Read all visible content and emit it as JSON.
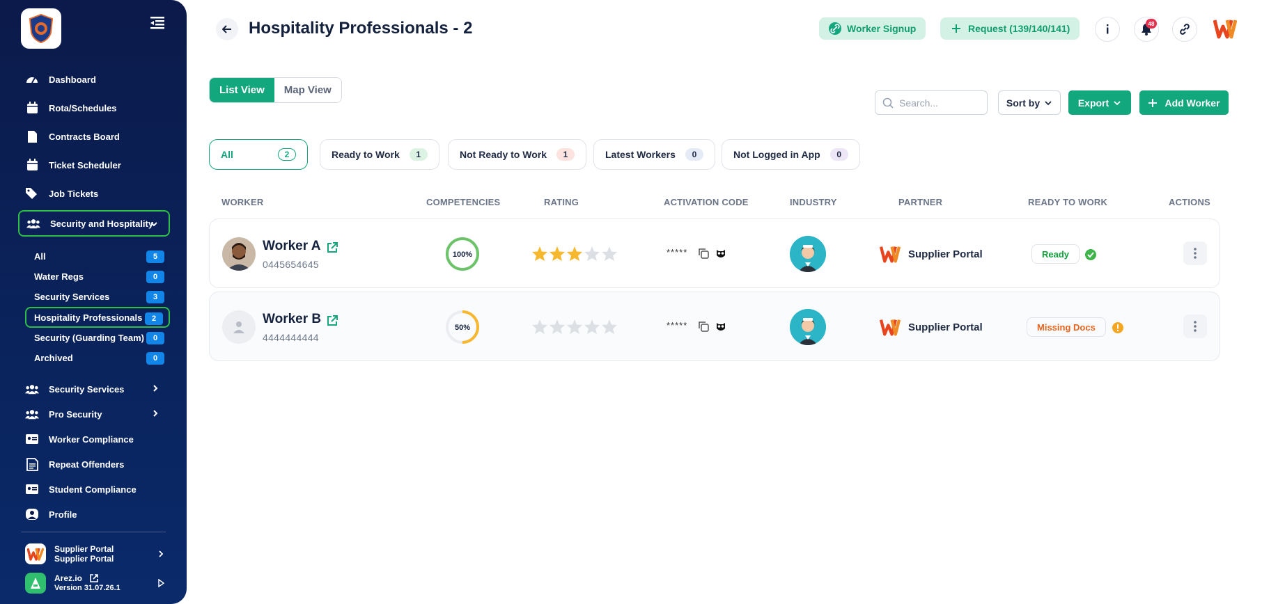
{
  "sidebar": {
    "nav": [
      {
        "label": "Dashboard",
        "icon": "gauge-icon"
      },
      {
        "label": "Rota/Schedules",
        "icon": "calendar-icon"
      },
      {
        "label": "Contracts Board",
        "icon": "file-icon"
      },
      {
        "label": "Ticket Scheduler",
        "icon": "calendar-icon"
      },
      {
        "label": "Job Tickets",
        "icon": "tags-icon"
      },
      {
        "label": "Security and Hospitality",
        "icon": "users-icon"
      }
    ],
    "subnav": [
      {
        "label": "All",
        "count": "5"
      },
      {
        "label": "Water Regs",
        "count": "0"
      },
      {
        "label": "Security Services",
        "count": "3"
      },
      {
        "label": "Hospitality Professionals",
        "count": "2"
      },
      {
        "label": "Security (Guarding Team)",
        "count": "0"
      },
      {
        "label": "Archived",
        "count": "0"
      }
    ],
    "nav2": [
      {
        "label": "Security Services"
      },
      {
        "label": "Pro Security"
      },
      {
        "label": "Worker Compliance"
      },
      {
        "label": "Repeat Offenders"
      },
      {
        "label": "Student Compliance"
      },
      {
        "label": "Profile"
      }
    ],
    "portal": {
      "line1": "Supplier Portal",
      "line2": "Supplier Portal"
    },
    "app": {
      "name": "Arez.io",
      "version": "Version 31.07.26.1"
    }
  },
  "header": {
    "title": "Hospitality Professionals - 2",
    "worker_signup": "Worker Signup",
    "request": "Request (139/140/141)",
    "notif_count": "48"
  },
  "views": {
    "list": "List View",
    "map": "Map View"
  },
  "toolbar": {
    "search_placeholder": "Search...",
    "sort": "Sort by",
    "export": "Export",
    "add": "Add Worker"
  },
  "filters": [
    {
      "label": "All",
      "count": "2"
    },
    {
      "label": "Ready to Work",
      "count": "1"
    },
    {
      "label": "Not Ready to Work",
      "count": "1"
    },
    {
      "label": "Latest Workers",
      "count": "0"
    },
    {
      "label": "Not Logged in App",
      "count": "0"
    }
  ],
  "columns": [
    "WORKER",
    "COMPETENCIES",
    "RATING",
    "ACTIVATION CODE",
    "INDUSTRY",
    "PARTNER",
    "READY TO WORK",
    "ACTIONS"
  ],
  "workers": [
    {
      "name": "Worker A",
      "phone": "0445654645",
      "competency": "100%",
      "competency_value": 100,
      "rating": 3,
      "code": "*****",
      "partner": "Supplier Portal",
      "status": "Ready",
      "status_color": "#12a03c"
    },
    {
      "name": "Worker B",
      "phone": "4444444444",
      "competency": "50%",
      "competency_value": 50,
      "rating": 0,
      "code": "*****",
      "partner": "Supplier Portal",
      "status": "Missing Docs",
      "status_color": "#e8641e"
    }
  ],
  "colors": {
    "accent": "#12a77d",
    "sidebar": "#0b1a4a",
    "active_outline": "#2fbf47"
  }
}
